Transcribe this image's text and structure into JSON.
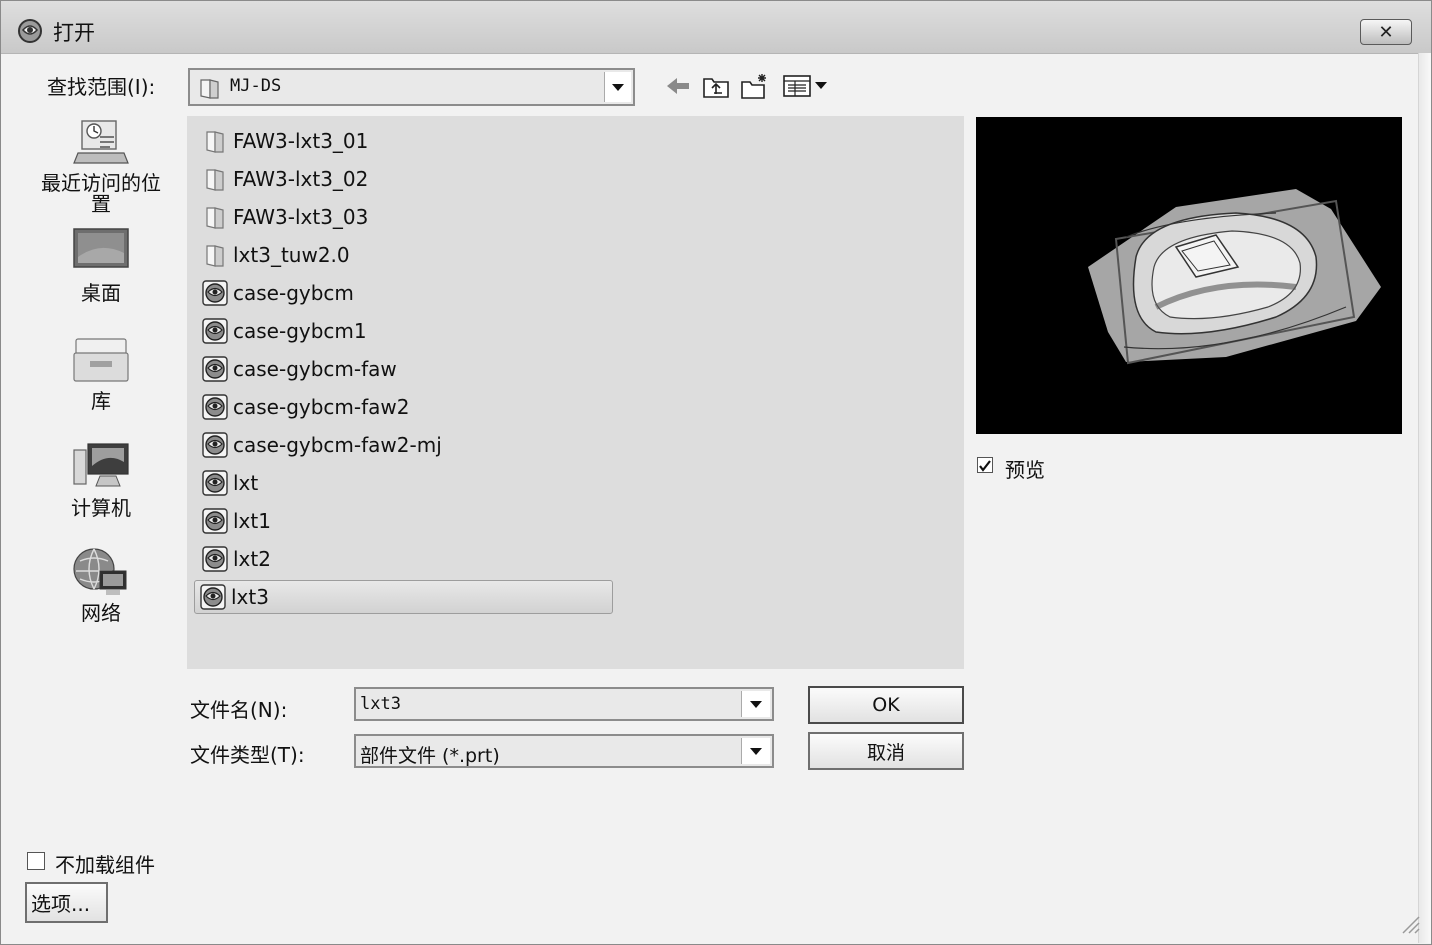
{
  "window": {
    "title": "打开",
    "close_label": "✕"
  },
  "look_in": {
    "label": "查找范围(I):",
    "value": "MJ-DS"
  },
  "places": [
    {
      "label": "最近访问的位置",
      "icon": "recent-places-icon"
    },
    {
      "label": "桌面",
      "icon": "desktop-icon"
    },
    {
      "label": "库",
      "icon": "library-icon"
    },
    {
      "label": "计算机",
      "icon": "computer-icon"
    },
    {
      "label": "网络",
      "icon": "network-icon"
    }
  ],
  "files": [
    {
      "name": "FAW3-lxt3_01",
      "type": "folder"
    },
    {
      "name": "FAW3-lxt3_02",
      "type": "folder"
    },
    {
      "name": "FAW3-lxt3_03",
      "type": "folder"
    },
    {
      "name": "lxt3_tuw2.0",
      "type": "folder"
    },
    {
      "name": "case-gybcm",
      "type": "part"
    },
    {
      "name": "case-gybcm1",
      "type": "part"
    },
    {
      "name": "case-gybcm-faw",
      "type": "part"
    },
    {
      "name": "case-gybcm-faw2",
      "type": "part"
    },
    {
      "name": "case-gybcm-faw2-mj",
      "type": "part"
    },
    {
      "name": "lxt",
      "type": "part"
    },
    {
      "name": "lxt1",
      "type": "part"
    },
    {
      "name": "lxt2",
      "type": "part"
    },
    {
      "name": "lxt3",
      "type": "part",
      "selected": true
    }
  ],
  "preview": {
    "checkbox_label": "预览",
    "checked": true
  },
  "filename": {
    "label": "文件名(N):",
    "value": "lxt3"
  },
  "filetype": {
    "label": "文件类型(T):",
    "value": "部件文件 (*.prt)"
  },
  "buttons": {
    "ok": "OK",
    "cancel": "取消",
    "options": "选项..."
  },
  "no_load_components": {
    "label": "不加载组件",
    "checked": false
  }
}
